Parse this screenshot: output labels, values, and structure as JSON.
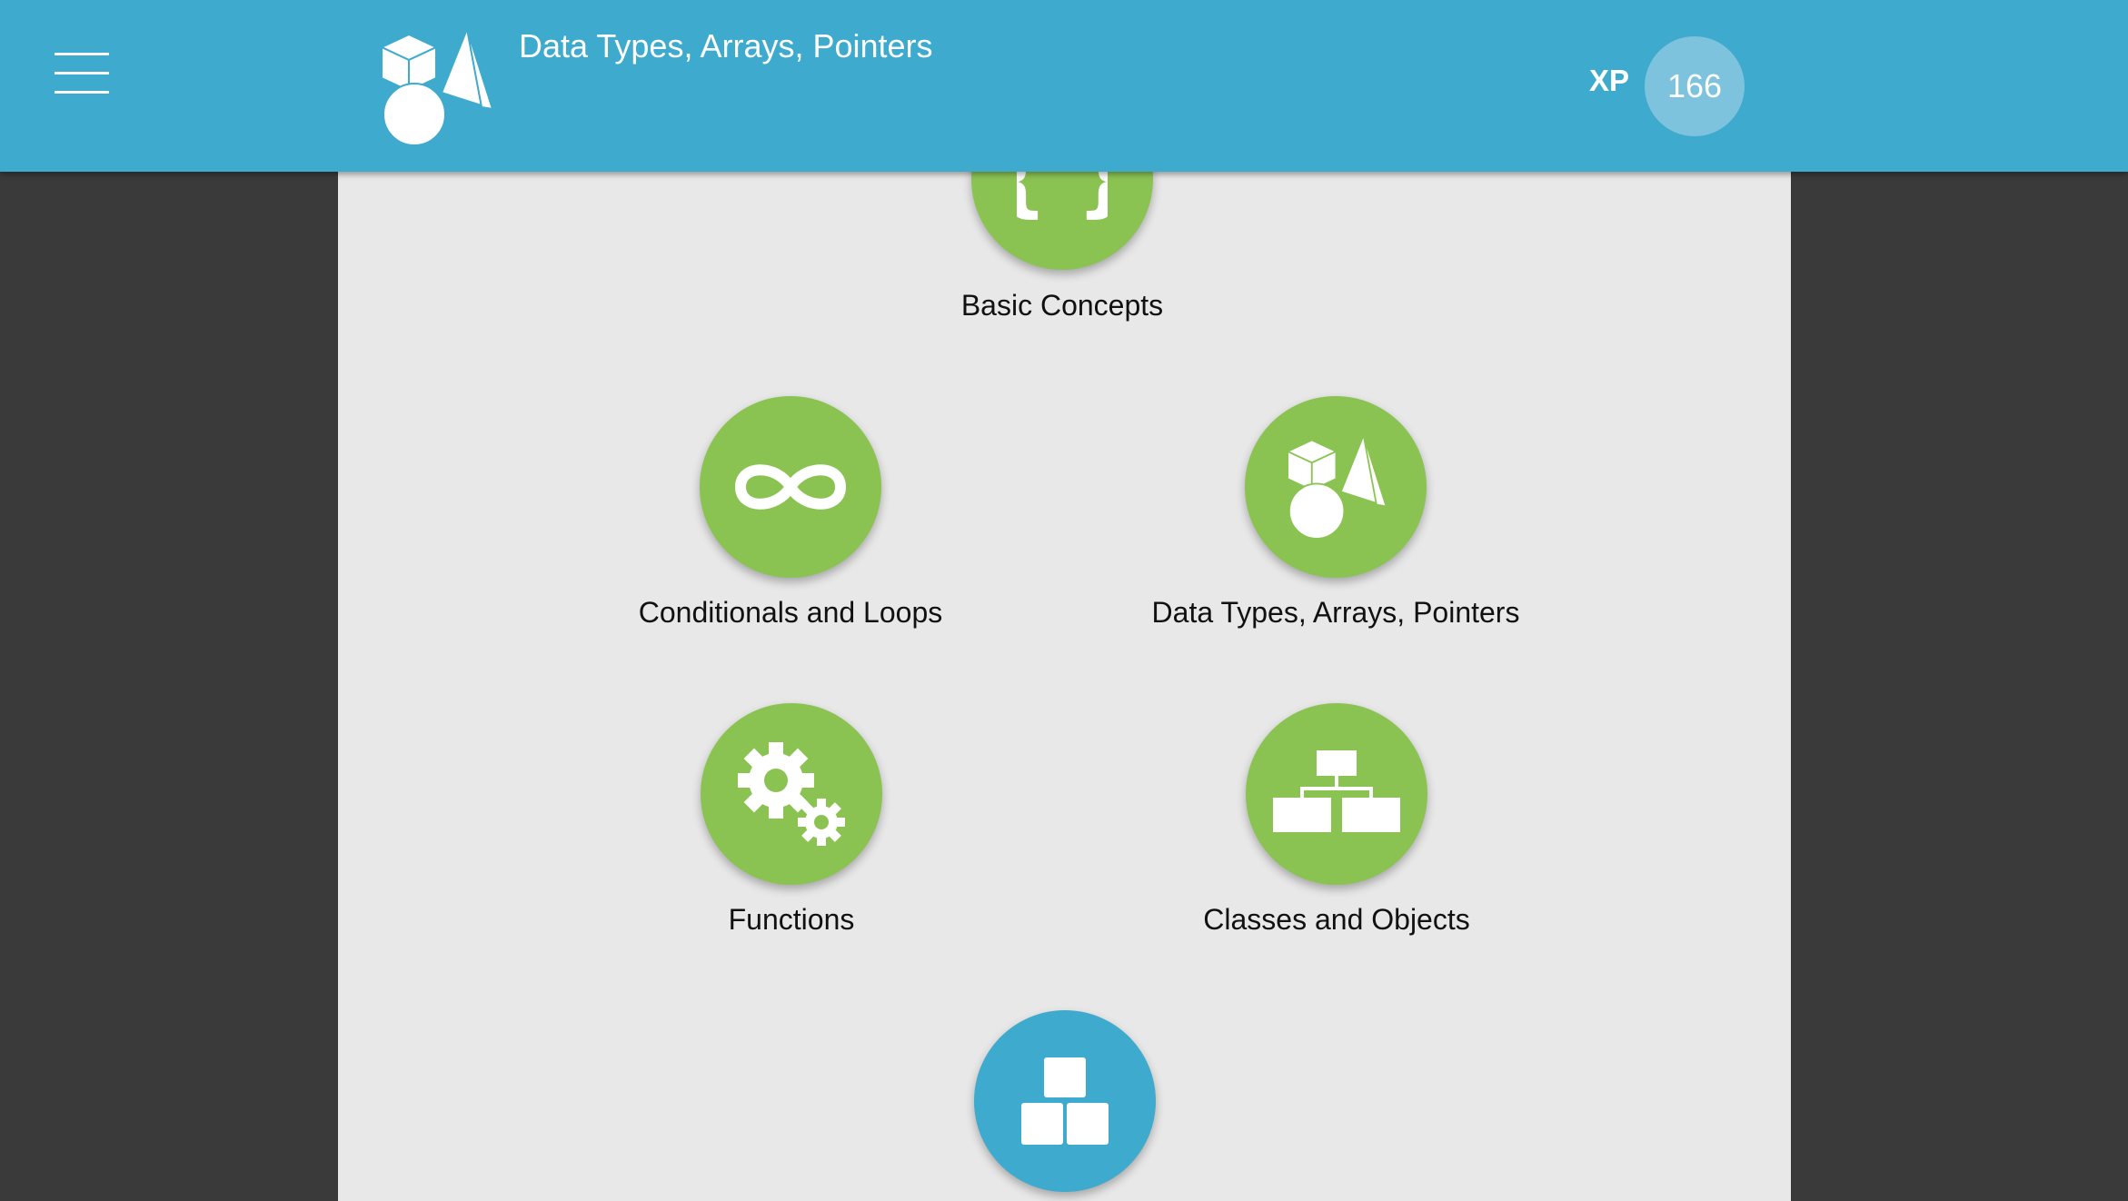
{
  "header": {
    "title": "Data Types, Arrays, Pointers",
    "xp_label": "XP",
    "xp_value": "166",
    "menu_icon": "hamburger-menu-icon",
    "logo_icon": "shapes-icon"
  },
  "colors": {
    "header": "#3eaacd",
    "node_completed": "#8bc353",
    "node_current": "#3eaacd",
    "panel": "#e8e8e8",
    "background": "#3a3a3a",
    "xp_badge": "#7ec3dd"
  },
  "modules": [
    {
      "label": "Basic Concepts",
      "icon": "curly-braces-icon",
      "status": "completed"
    },
    {
      "label": "Conditionals and Loops",
      "icon": "infinity-icon",
      "status": "completed"
    },
    {
      "label": "Data Types, Arrays, Pointers",
      "icon": "shapes-icon",
      "status": "completed"
    },
    {
      "label": "Functions",
      "icon": "gears-icon",
      "status": "completed"
    },
    {
      "label": "Classes and Objects",
      "icon": "hierarchy-icon",
      "status": "completed"
    },
    {
      "label": "",
      "icon": "blocks-icon",
      "status": "current"
    }
  ]
}
